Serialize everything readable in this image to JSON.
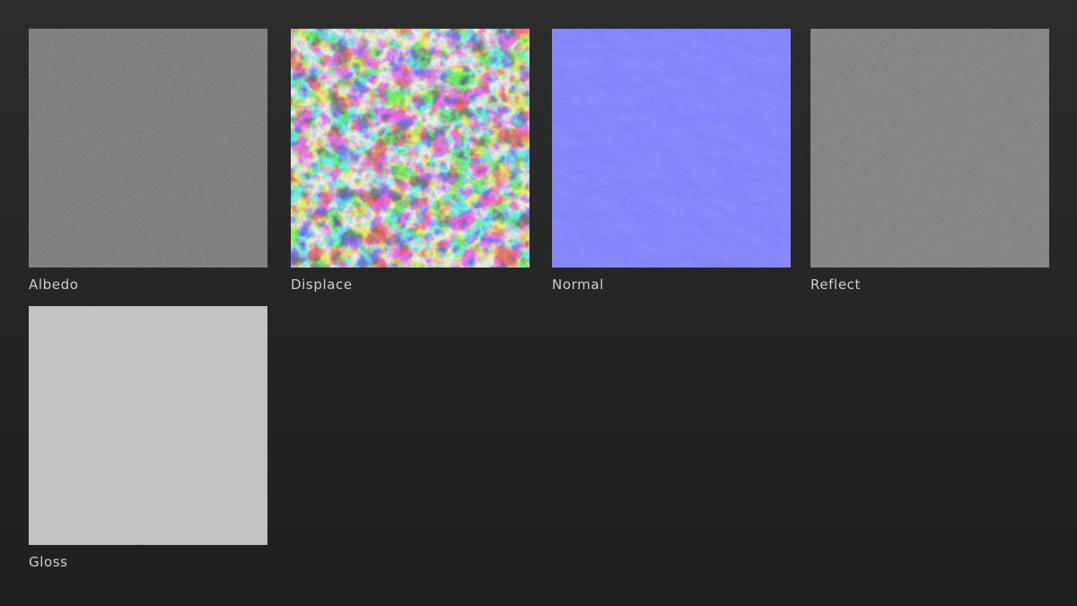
{
  "texture_maps": [
    {
      "label": "Albedo",
      "base_color": "#6a6a6a"
    },
    {
      "label": "Displace",
      "base_color": "#2a2a2a"
    },
    {
      "label": "Normal",
      "base_color": "#7f7ffb"
    },
    {
      "label": "Reflect",
      "base_color": "#6e6e6e"
    },
    {
      "label": "Gloss",
      "base_color": "#b9b9b9"
    }
  ]
}
